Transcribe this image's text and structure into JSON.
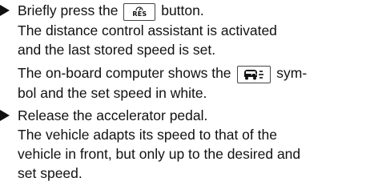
{
  "steps": [
    {
      "pre": "Briefly press the",
      "post": "button.",
      "button_label": "RES",
      "result_line1": "The distance control assistant is activated",
      "result_line2": "and the last stored speed is set.",
      "info_pre": "The on-board computer shows the",
      "info_post": "sym-",
      "info_line2": "bol and the set speed in white."
    },
    {
      "action": "Release the accelerator pedal.",
      "result_line1": "The vehicle adapts its speed to that of the",
      "result_line2": "vehicle in front, but only up to the desired and",
      "result_line3": "set speed."
    }
  ],
  "icons": {
    "button_icon": "speedometer-icon",
    "symbol_icon": "distance-assist-car-icon"
  }
}
